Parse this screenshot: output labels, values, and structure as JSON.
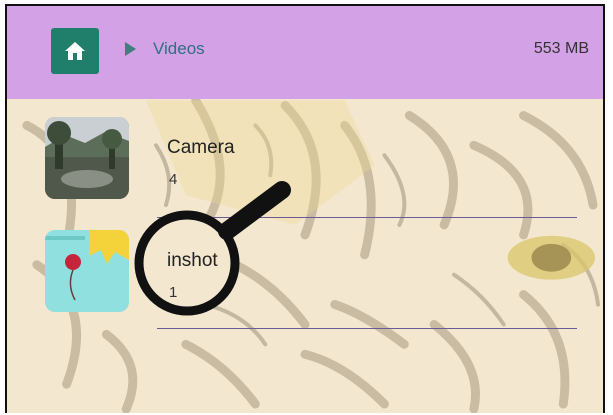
{
  "header": {
    "home_icon": "home-icon",
    "breadcrumb": "Videos",
    "storage": "553 MB"
  },
  "folders": [
    {
      "name": "Camera",
      "count": "4"
    },
    {
      "name": "inshot",
      "count": "1"
    }
  ],
  "colors": {
    "header_bg": "#d3a1e6",
    "home_button": "#1f7f6b",
    "breadcrumb_text": "#2f6f7f"
  }
}
